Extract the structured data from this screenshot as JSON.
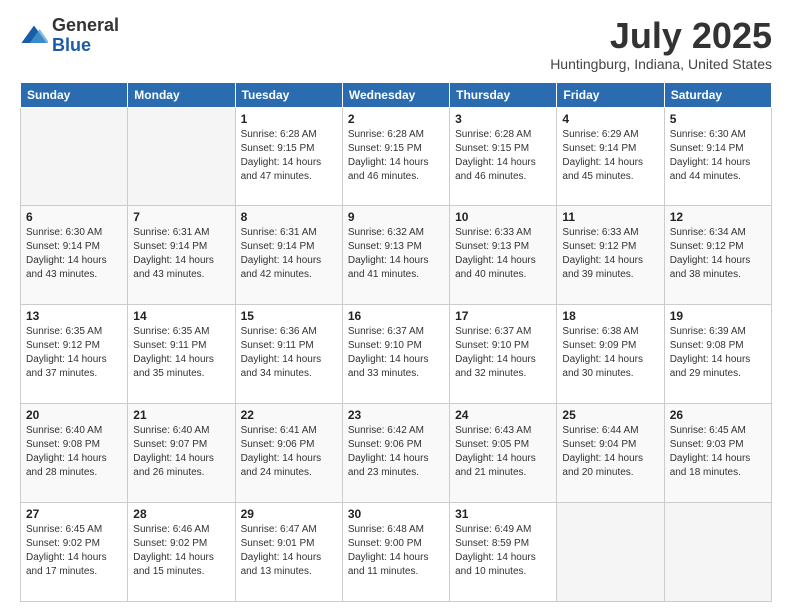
{
  "header": {
    "logo": {
      "general": "General",
      "blue": "Blue"
    },
    "title": "July 2025",
    "location": "Huntingburg, Indiana, United States"
  },
  "weekdays": [
    "Sunday",
    "Monday",
    "Tuesday",
    "Wednesday",
    "Thursday",
    "Friday",
    "Saturday"
  ],
  "weeks": [
    [
      {
        "day": "",
        "empty": true
      },
      {
        "day": "",
        "empty": true
      },
      {
        "day": "1",
        "sunrise": "6:28 AM",
        "sunset": "9:15 PM",
        "daylight": "14 hours and 47 minutes."
      },
      {
        "day": "2",
        "sunrise": "6:28 AM",
        "sunset": "9:15 PM",
        "daylight": "14 hours and 46 minutes."
      },
      {
        "day": "3",
        "sunrise": "6:28 AM",
        "sunset": "9:15 PM",
        "daylight": "14 hours and 46 minutes."
      },
      {
        "day": "4",
        "sunrise": "6:29 AM",
        "sunset": "9:14 PM",
        "daylight": "14 hours and 45 minutes."
      },
      {
        "day": "5",
        "sunrise": "6:30 AM",
        "sunset": "9:14 PM",
        "daylight": "14 hours and 44 minutes."
      }
    ],
    [
      {
        "day": "6",
        "sunrise": "6:30 AM",
        "sunset": "9:14 PM",
        "daylight": "14 hours and 43 minutes."
      },
      {
        "day": "7",
        "sunrise": "6:31 AM",
        "sunset": "9:14 PM",
        "daylight": "14 hours and 43 minutes."
      },
      {
        "day": "8",
        "sunrise": "6:31 AM",
        "sunset": "9:14 PM",
        "daylight": "14 hours and 42 minutes."
      },
      {
        "day": "9",
        "sunrise": "6:32 AM",
        "sunset": "9:13 PM",
        "daylight": "14 hours and 41 minutes."
      },
      {
        "day": "10",
        "sunrise": "6:33 AM",
        "sunset": "9:13 PM",
        "daylight": "14 hours and 40 minutes."
      },
      {
        "day": "11",
        "sunrise": "6:33 AM",
        "sunset": "9:12 PM",
        "daylight": "14 hours and 39 minutes."
      },
      {
        "day": "12",
        "sunrise": "6:34 AM",
        "sunset": "9:12 PM",
        "daylight": "14 hours and 38 minutes."
      }
    ],
    [
      {
        "day": "13",
        "sunrise": "6:35 AM",
        "sunset": "9:12 PM",
        "daylight": "14 hours and 37 minutes."
      },
      {
        "day": "14",
        "sunrise": "6:35 AM",
        "sunset": "9:11 PM",
        "daylight": "14 hours and 35 minutes."
      },
      {
        "day": "15",
        "sunrise": "6:36 AM",
        "sunset": "9:11 PM",
        "daylight": "14 hours and 34 minutes."
      },
      {
        "day": "16",
        "sunrise": "6:37 AM",
        "sunset": "9:10 PM",
        "daylight": "14 hours and 33 minutes."
      },
      {
        "day": "17",
        "sunrise": "6:37 AM",
        "sunset": "9:10 PM",
        "daylight": "14 hours and 32 minutes."
      },
      {
        "day": "18",
        "sunrise": "6:38 AM",
        "sunset": "9:09 PM",
        "daylight": "14 hours and 30 minutes."
      },
      {
        "day": "19",
        "sunrise": "6:39 AM",
        "sunset": "9:08 PM",
        "daylight": "14 hours and 29 minutes."
      }
    ],
    [
      {
        "day": "20",
        "sunrise": "6:40 AM",
        "sunset": "9:08 PM",
        "daylight": "14 hours and 28 minutes."
      },
      {
        "day": "21",
        "sunrise": "6:40 AM",
        "sunset": "9:07 PM",
        "daylight": "14 hours and 26 minutes."
      },
      {
        "day": "22",
        "sunrise": "6:41 AM",
        "sunset": "9:06 PM",
        "daylight": "14 hours and 24 minutes."
      },
      {
        "day": "23",
        "sunrise": "6:42 AM",
        "sunset": "9:06 PM",
        "daylight": "14 hours and 23 minutes."
      },
      {
        "day": "24",
        "sunrise": "6:43 AM",
        "sunset": "9:05 PM",
        "daylight": "14 hours and 21 minutes."
      },
      {
        "day": "25",
        "sunrise": "6:44 AM",
        "sunset": "9:04 PM",
        "daylight": "14 hours and 20 minutes."
      },
      {
        "day": "26",
        "sunrise": "6:45 AM",
        "sunset": "9:03 PM",
        "daylight": "14 hours and 18 minutes."
      }
    ],
    [
      {
        "day": "27",
        "sunrise": "6:45 AM",
        "sunset": "9:02 PM",
        "daylight": "14 hours and 17 minutes."
      },
      {
        "day": "28",
        "sunrise": "6:46 AM",
        "sunset": "9:02 PM",
        "daylight": "14 hours and 15 minutes."
      },
      {
        "day": "29",
        "sunrise": "6:47 AM",
        "sunset": "9:01 PM",
        "daylight": "14 hours and 13 minutes."
      },
      {
        "day": "30",
        "sunrise": "6:48 AM",
        "sunset": "9:00 PM",
        "daylight": "14 hours and 11 minutes."
      },
      {
        "day": "31",
        "sunrise": "6:49 AM",
        "sunset": "8:59 PM",
        "daylight": "14 hours and 10 minutes."
      },
      {
        "day": "",
        "empty": true
      },
      {
        "day": "",
        "empty": true
      }
    ]
  ]
}
